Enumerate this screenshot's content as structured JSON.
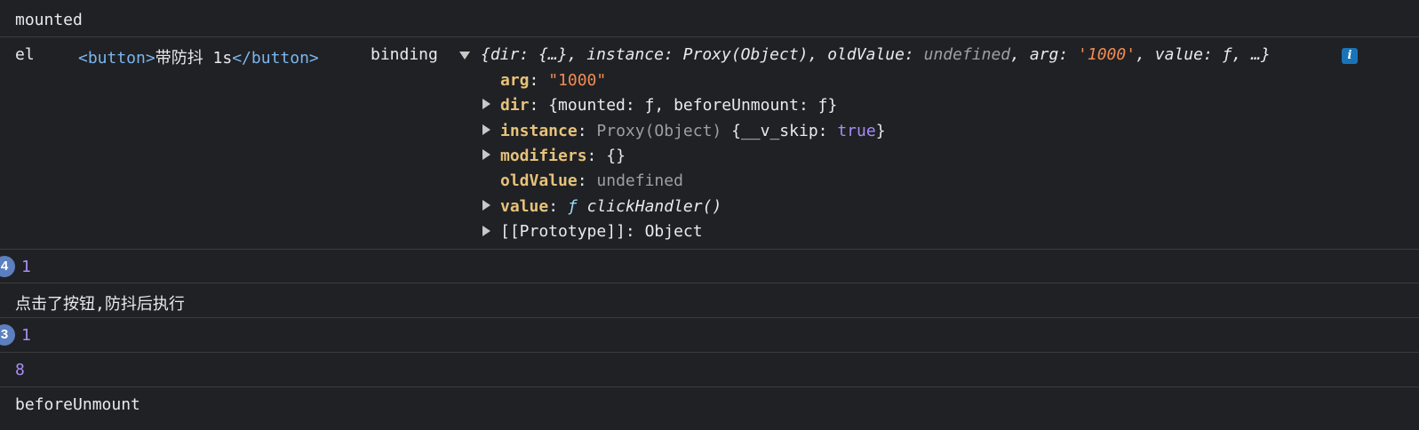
{
  "log": {
    "mounted": "mounted",
    "el_label": "el",
    "el_tag_open": "<button>",
    "el_text": "带防抖 1s",
    "el_tag_close": "</button>",
    "binding_label": "binding",
    "summary": {
      "brace_open": "{",
      "dir_key": "dir",
      "dir_val": "{…}",
      "instance_key": "instance",
      "instance_val": "Proxy(Object)",
      "oldValue_key": "oldValue",
      "oldValue_val": "undefined",
      "arg_key": "arg",
      "arg_val": "'1000'",
      "value_key": "value",
      "value_val": "ƒ",
      "ellipsis": "…}",
      "sep": ", ",
      "colon": ": "
    },
    "props": {
      "arg_key": "arg",
      "arg_val": "\"1000\"",
      "dir_key": "dir",
      "dir_val": "{mounted: ƒ, beforeUnmount: ƒ}",
      "instance_key": "instance",
      "instance_proxy": "Proxy(Object)",
      "instance_obj_open": "{__v_skip: ",
      "instance_true": "true",
      "instance_obj_close": "}",
      "modifiers_key": "modifiers",
      "modifiers_val": "{}",
      "oldValue_key": "oldValue",
      "oldValue_val": "undefined",
      "value_key": "value",
      "value_f": "ƒ",
      "value_fn": "clickHandler()",
      "prototype_key": "[[Prototype]]",
      "prototype_val": "Object",
      "colon": ": "
    },
    "rows": {
      "r1_count": "4",
      "r1_value": "1",
      "r2_text": "点击了按钮,防抖后执行",
      "r3_count": "3",
      "r3_value": "1",
      "r4_value": "8",
      "r5_text": "beforeUnmount"
    }
  },
  "colors": {
    "background": "#202124",
    "number": "#a98ef5",
    "tag": "#7ab6ef",
    "string": "#f28b54",
    "badge": "#5b7fbf"
  }
}
